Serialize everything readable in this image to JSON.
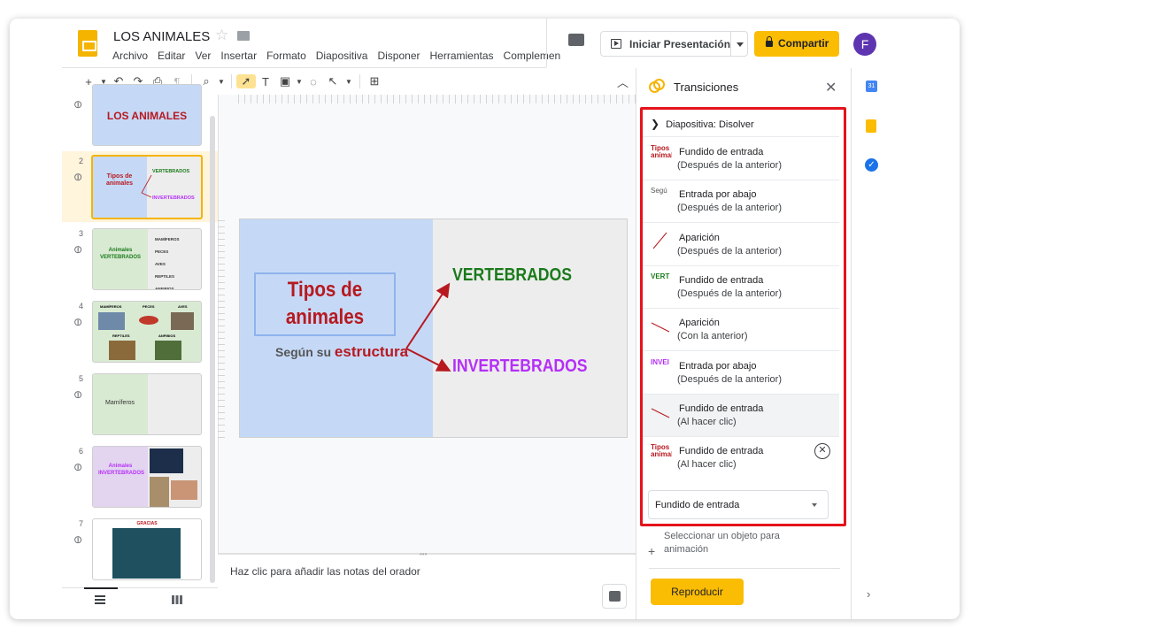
{
  "doc": {
    "title": "LOS ANIMALES"
  },
  "menu": [
    "Archivo",
    "Editar",
    "Ver",
    "Insertar",
    "Formato",
    "Diapositiva",
    "Disponer",
    "Herramientas",
    "Complemen"
  ],
  "header": {
    "present_label": "Iniciar Presentación",
    "share_label": "Compartir",
    "avatar_letter": "F"
  },
  "slides_panel": {
    "slides": [
      {
        "number": "",
        "title": "LOS ANIMALES"
      },
      {
        "number": "2",
        "title": "Tipos de animales"
      },
      {
        "number": "3",
        "title": "Animales VERTEBRADOS"
      },
      {
        "number": "4",
        "title": ""
      },
      {
        "number": "5",
        "title": "Mamíferos"
      },
      {
        "number": "6",
        "title": "Animales INVERTEBRADOS"
      },
      {
        "number": "7",
        "title": "GRACIAS"
      }
    ],
    "slide2_labels": {
      "vert": "VERTEBRADOS",
      "invert": "INVERTEBRADOS"
    },
    "slide3_items": [
      "MAMÍFEROS",
      "PECES",
      "AVES",
      "REPTILES",
      "ANFIBIOS"
    ],
    "slide4_labels": [
      "MAMÍFEROS",
      "PECES",
      "AVES",
      "REPTILES",
      "ANFIBIOS"
    ]
  },
  "current_slide": {
    "title": "Tipos de animales",
    "subtitle_prefix": "Según su ",
    "subtitle_emphasis": "estructura",
    "vert": "VERTEBRADOS",
    "invert": "INVERTEBRADOS"
  },
  "notes": {
    "placeholder": "Haz clic para añadir las notas del orador"
  },
  "transitions": {
    "title": "Transiciones",
    "slide_transition": "Diapositiva: Disolver",
    "animations": [
      {
        "thumb": "Tipos animal",
        "thumb_color": "#b7191f",
        "line1": "Fundido de entrada",
        "line2": "(Después de la anterior)"
      },
      {
        "thumb": "Segú",
        "thumb_color": "#555555",
        "line1": "Entrada por abajo",
        "line2": "(Después de la anterior)"
      },
      {
        "thumb": "",
        "thumb_color": "#b7191f",
        "line1": "Aparición",
        "line2": "(Después de la anterior)"
      },
      {
        "thumb": "VERT",
        "thumb_color": "#1a7a1a",
        "line1": "Fundido de entrada",
        "line2": "(Después de la anterior)"
      },
      {
        "thumb": "",
        "thumb_color": "#b7191f",
        "line1": "Aparición",
        "line2": "(Con la anterior)"
      },
      {
        "thumb": "INVEI",
        "thumb_color": "#b52ff7",
        "line1": "Entrada por abajo",
        "line2": "(Después de la anterior)"
      },
      {
        "thumb": "",
        "thumb_color": "#b7191f",
        "line1": "Fundido de entrada",
        "line2": "(Al hacer clic)"
      },
      {
        "thumb": "Tipos animal",
        "thumb_color": "#b7191f",
        "line1": "Fundido de entrada",
        "line2": "(Al hacer clic)"
      }
    ],
    "selected_effect": "Fundido de entrada",
    "add_object": "Seleccionar un objeto para animación",
    "play_label": "Reproducir"
  },
  "side_rail": {
    "calendar_day": "31"
  }
}
